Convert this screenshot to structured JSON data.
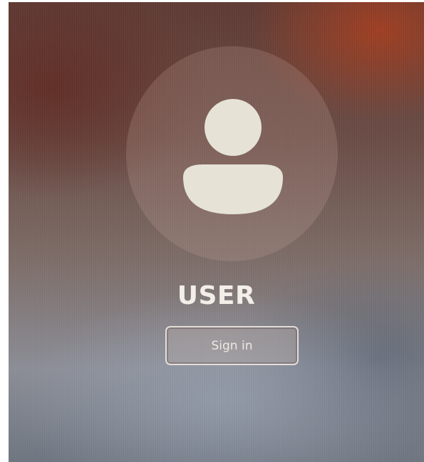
{
  "user": {
    "name": "USER",
    "avatar_icon": "user-avatar-icon"
  },
  "signin": {
    "label": "Sign in"
  },
  "colors": {
    "text": "#f2eee8",
    "avatar_glyph": "#e6e2d6"
  }
}
